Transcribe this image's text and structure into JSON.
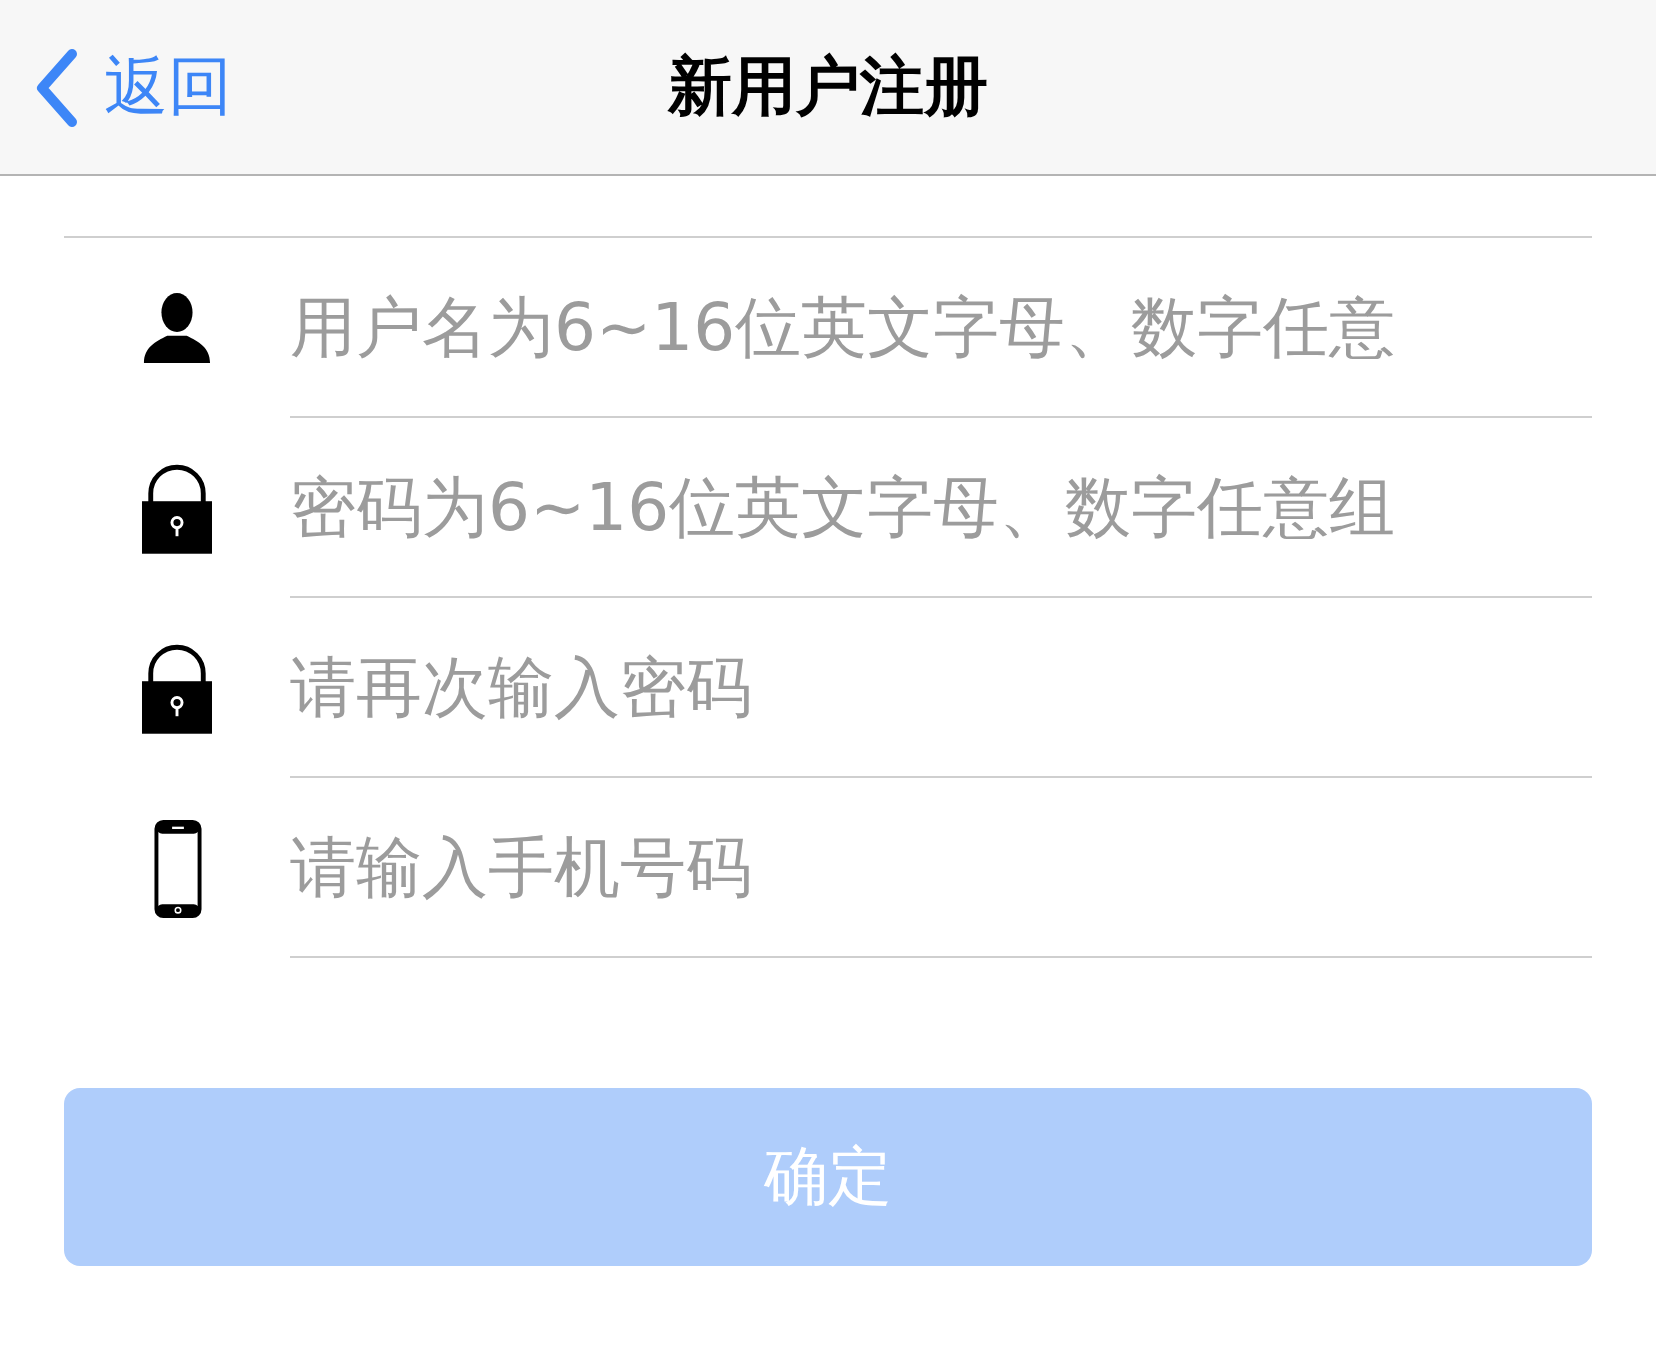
{
  "nav_bar": {
    "back_label": "返回",
    "title": "新用户注册"
  },
  "fields": [
    {
      "kind": "user",
      "placeholder": "用户名为6~16位英文字母、数字任意"
    },
    {
      "kind": "lock",
      "placeholder": "密码为6~16位英文字母、数字任意组"
    },
    {
      "kind": "lock",
      "placeholder": "请再次输入密码"
    },
    {
      "kind": "phone",
      "placeholder": "请输入手机号码"
    }
  ],
  "submit_button": {
    "label": "确定",
    "disabled": true
  }
}
